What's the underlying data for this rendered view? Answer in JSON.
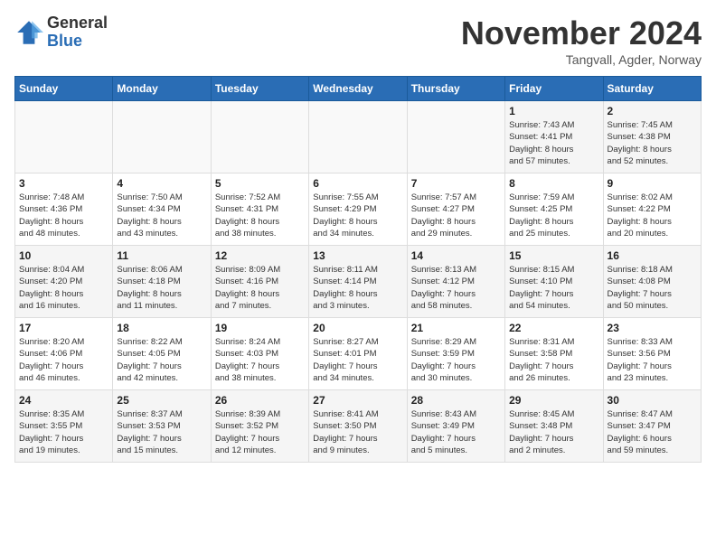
{
  "logo": {
    "text_general": "General",
    "text_blue": "Blue"
  },
  "header": {
    "title": "November 2024",
    "location": "Tangvall, Agder, Norway"
  },
  "weekdays": [
    "Sunday",
    "Monday",
    "Tuesday",
    "Wednesday",
    "Thursday",
    "Friday",
    "Saturday"
  ],
  "weeks": [
    [
      {
        "day": "",
        "info": ""
      },
      {
        "day": "",
        "info": ""
      },
      {
        "day": "",
        "info": ""
      },
      {
        "day": "",
        "info": ""
      },
      {
        "day": "",
        "info": ""
      },
      {
        "day": "1",
        "info": "Sunrise: 7:43 AM\nSunset: 4:41 PM\nDaylight: 8 hours\nand 57 minutes."
      },
      {
        "day": "2",
        "info": "Sunrise: 7:45 AM\nSunset: 4:38 PM\nDaylight: 8 hours\nand 52 minutes."
      }
    ],
    [
      {
        "day": "3",
        "info": "Sunrise: 7:48 AM\nSunset: 4:36 PM\nDaylight: 8 hours\nand 48 minutes."
      },
      {
        "day": "4",
        "info": "Sunrise: 7:50 AM\nSunset: 4:34 PM\nDaylight: 8 hours\nand 43 minutes."
      },
      {
        "day": "5",
        "info": "Sunrise: 7:52 AM\nSunset: 4:31 PM\nDaylight: 8 hours\nand 38 minutes."
      },
      {
        "day": "6",
        "info": "Sunrise: 7:55 AM\nSunset: 4:29 PM\nDaylight: 8 hours\nand 34 minutes."
      },
      {
        "day": "7",
        "info": "Sunrise: 7:57 AM\nSunset: 4:27 PM\nDaylight: 8 hours\nand 29 minutes."
      },
      {
        "day": "8",
        "info": "Sunrise: 7:59 AM\nSunset: 4:25 PM\nDaylight: 8 hours\nand 25 minutes."
      },
      {
        "day": "9",
        "info": "Sunrise: 8:02 AM\nSunset: 4:22 PM\nDaylight: 8 hours\nand 20 minutes."
      }
    ],
    [
      {
        "day": "10",
        "info": "Sunrise: 8:04 AM\nSunset: 4:20 PM\nDaylight: 8 hours\nand 16 minutes."
      },
      {
        "day": "11",
        "info": "Sunrise: 8:06 AM\nSunset: 4:18 PM\nDaylight: 8 hours\nand 11 minutes."
      },
      {
        "day": "12",
        "info": "Sunrise: 8:09 AM\nSunset: 4:16 PM\nDaylight: 8 hours\nand 7 minutes."
      },
      {
        "day": "13",
        "info": "Sunrise: 8:11 AM\nSunset: 4:14 PM\nDaylight: 8 hours\nand 3 minutes."
      },
      {
        "day": "14",
        "info": "Sunrise: 8:13 AM\nSunset: 4:12 PM\nDaylight: 7 hours\nand 58 minutes."
      },
      {
        "day": "15",
        "info": "Sunrise: 8:15 AM\nSunset: 4:10 PM\nDaylight: 7 hours\nand 54 minutes."
      },
      {
        "day": "16",
        "info": "Sunrise: 8:18 AM\nSunset: 4:08 PM\nDaylight: 7 hours\nand 50 minutes."
      }
    ],
    [
      {
        "day": "17",
        "info": "Sunrise: 8:20 AM\nSunset: 4:06 PM\nDaylight: 7 hours\nand 46 minutes."
      },
      {
        "day": "18",
        "info": "Sunrise: 8:22 AM\nSunset: 4:05 PM\nDaylight: 7 hours\nand 42 minutes."
      },
      {
        "day": "19",
        "info": "Sunrise: 8:24 AM\nSunset: 4:03 PM\nDaylight: 7 hours\nand 38 minutes."
      },
      {
        "day": "20",
        "info": "Sunrise: 8:27 AM\nSunset: 4:01 PM\nDaylight: 7 hours\nand 34 minutes."
      },
      {
        "day": "21",
        "info": "Sunrise: 8:29 AM\nSunset: 3:59 PM\nDaylight: 7 hours\nand 30 minutes."
      },
      {
        "day": "22",
        "info": "Sunrise: 8:31 AM\nSunset: 3:58 PM\nDaylight: 7 hours\nand 26 minutes."
      },
      {
        "day": "23",
        "info": "Sunrise: 8:33 AM\nSunset: 3:56 PM\nDaylight: 7 hours\nand 23 minutes."
      }
    ],
    [
      {
        "day": "24",
        "info": "Sunrise: 8:35 AM\nSunset: 3:55 PM\nDaylight: 7 hours\nand 19 minutes."
      },
      {
        "day": "25",
        "info": "Sunrise: 8:37 AM\nSunset: 3:53 PM\nDaylight: 7 hours\nand 15 minutes."
      },
      {
        "day": "26",
        "info": "Sunrise: 8:39 AM\nSunset: 3:52 PM\nDaylight: 7 hours\nand 12 minutes."
      },
      {
        "day": "27",
        "info": "Sunrise: 8:41 AM\nSunset: 3:50 PM\nDaylight: 7 hours\nand 9 minutes."
      },
      {
        "day": "28",
        "info": "Sunrise: 8:43 AM\nSunset: 3:49 PM\nDaylight: 7 hours\nand 5 minutes."
      },
      {
        "day": "29",
        "info": "Sunrise: 8:45 AM\nSunset: 3:48 PM\nDaylight: 7 hours\nand 2 minutes."
      },
      {
        "day": "30",
        "info": "Sunrise: 8:47 AM\nSunset: 3:47 PM\nDaylight: 6 hours\nand 59 minutes."
      }
    ]
  ]
}
